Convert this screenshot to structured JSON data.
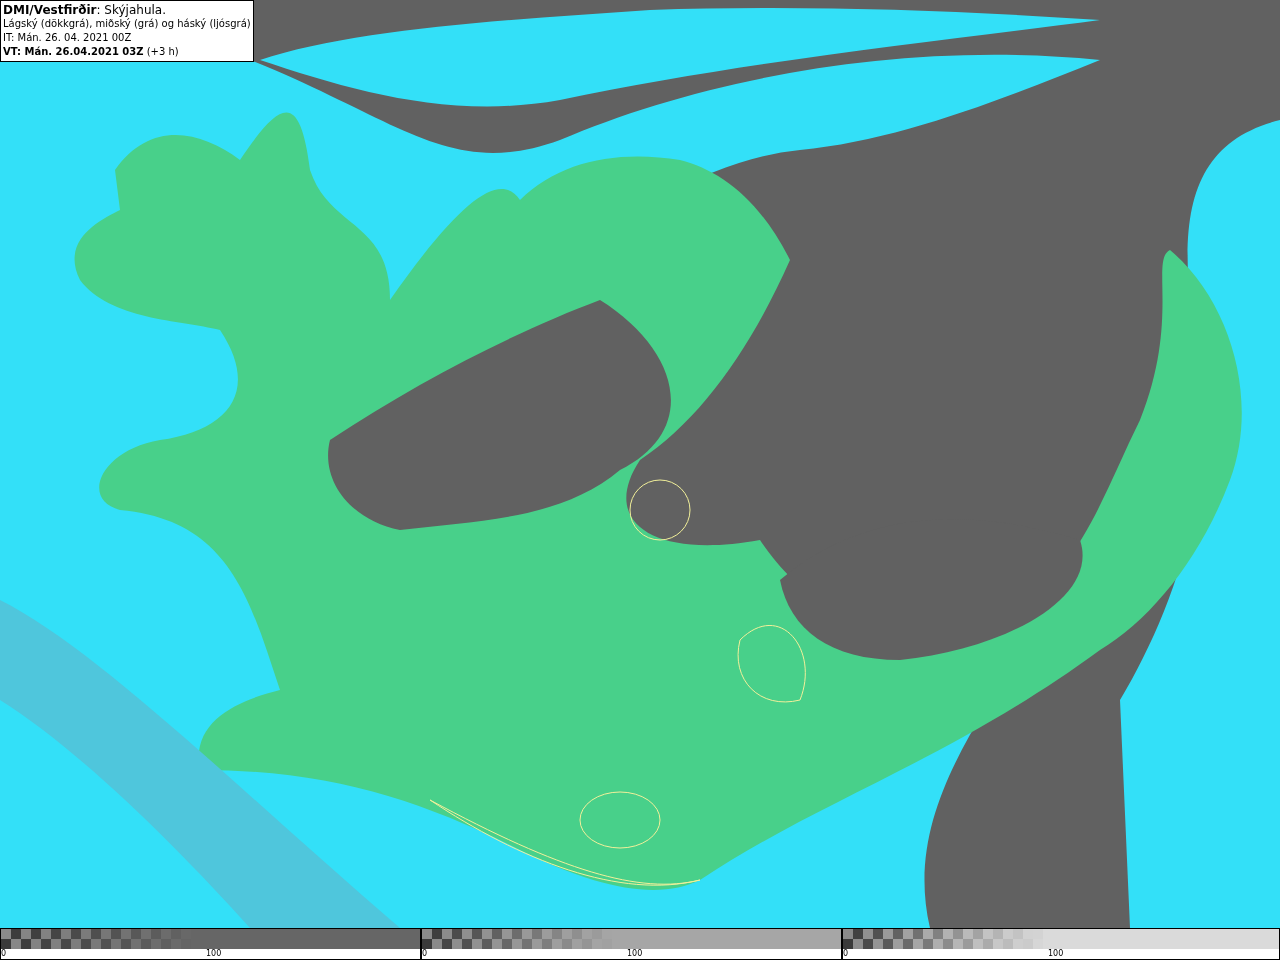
{
  "legend": {
    "lines": [
      "**DMI/Vestfirðir**: Skýjahula.",
      "Lágský (dökkgrá), miðský (grá) og háský (ljósgrá)",
      "IT: Mán. 26. 04. 2021 00Z",
      "**VT: Mán. 26.04.2021 03Z** (+3 h)"
    ]
  },
  "colorbars": [
    {
      "color": "#666666",
      "min_label": "0",
      "mid_label": "100"
    },
    {
      "color": "#a6a6a6",
      "min_label": "0",
      "mid_label": "100"
    },
    {
      "color": "#dadada",
      "min_label": "0",
      "mid_label": "100"
    }
  ]
}
